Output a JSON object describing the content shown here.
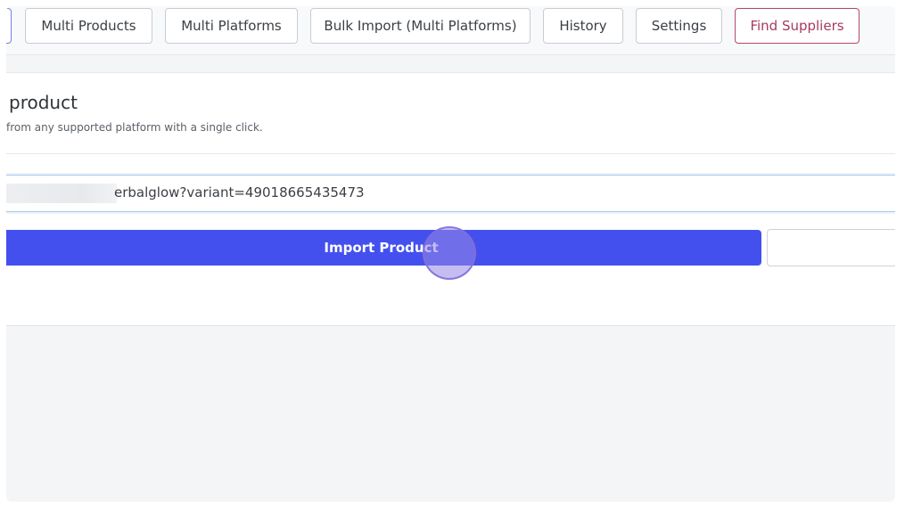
{
  "nav": {
    "tabs": [
      {
        "label": "Multi Products"
      },
      {
        "label": "Multi Platforms"
      },
      {
        "label": "Bulk Import (Multi Platforms)"
      },
      {
        "label": "History"
      },
      {
        "label": "Settings"
      },
      {
        "label": "Find Suppliers"
      }
    ]
  },
  "card": {
    "title": "product",
    "subtitle": "from any supported platform with a single click."
  },
  "url_input": {
    "value": "erbalglow?variant=49018665435473"
  },
  "actions": {
    "import_label": "Import Product"
  },
  "colors": {
    "primary": "#4450ee",
    "suppliers_accent": "#b5476a",
    "input_focus_border": "#a9c7ee",
    "click_indicator": "#9687e6"
  }
}
